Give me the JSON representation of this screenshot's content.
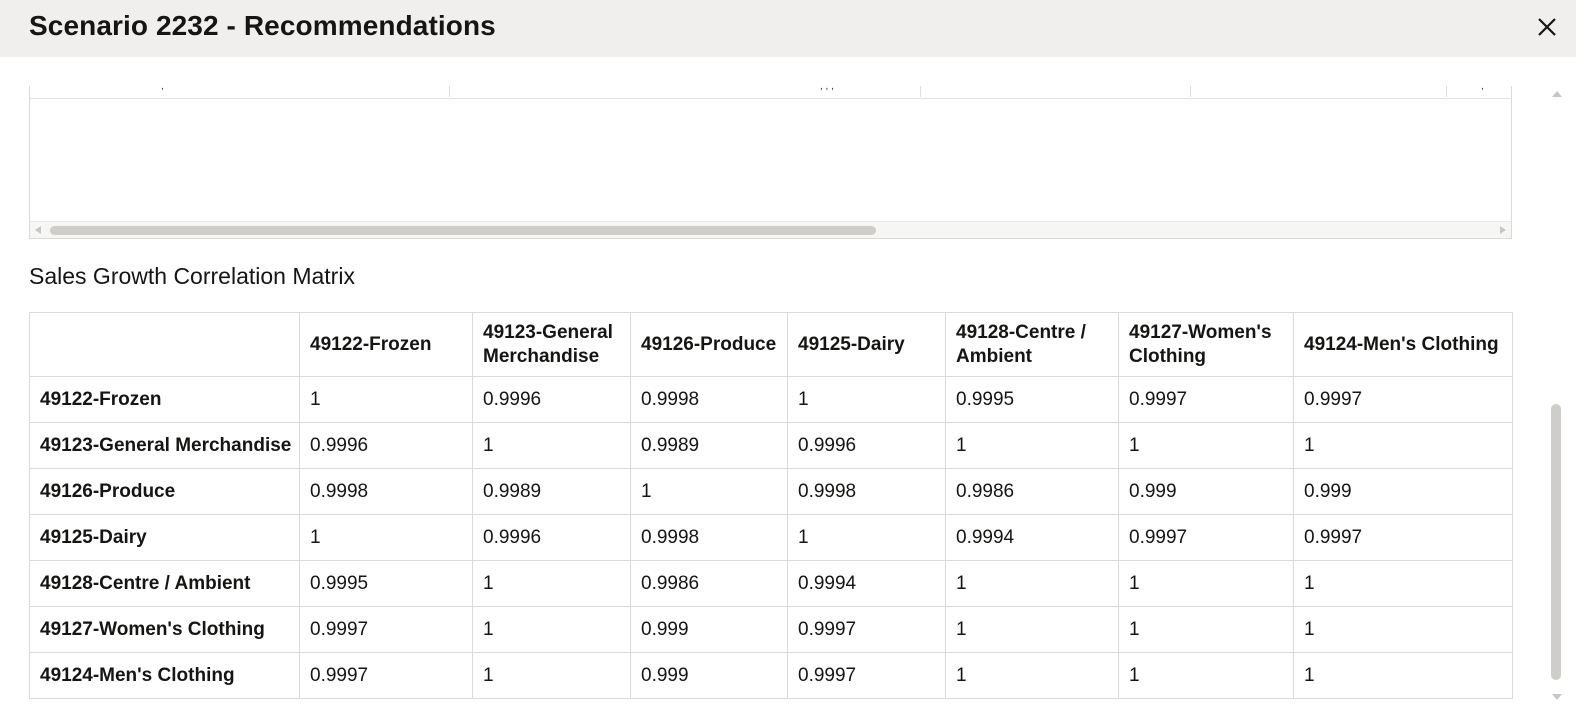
{
  "dialog": {
    "title": "Scenario 2232 - Recommendations",
    "close_icon": "close-icon"
  },
  "upper_grid": {
    "fragment_text": [
      ",",
      ", , ,",
      ","
    ]
  },
  "matrix": {
    "title": "Sales Growth Correlation Matrix",
    "columns": [
      "",
      "49122-Frozen",
      "49123-General Merchandise",
      "49126-Produce",
      "49125-Dairy",
      "49128-Centre / Ambient",
      "49127-Women's Clothing",
      "49124-Men's Clothing"
    ],
    "rows": [
      {
        "label": "49122-Frozen",
        "values": [
          "1",
          "0.9996",
          "0.9998",
          "1",
          "0.9995",
          "0.9997",
          "0.9997"
        ]
      },
      {
        "label": "49123-General Merchandise",
        "values": [
          "0.9996",
          "1",
          "0.9989",
          "0.9996",
          "1",
          "1",
          "1"
        ]
      },
      {
        "label": "49126-Produce",
        "values": [
          "0.9998",
          "0.9989",
          "1",
          "0.9998",
          "0.9986",
          "0.999",
          "0.999"
        ]
      },
      {
        "label": "49125-Dairy",
        "values": [
          "1",
          "0.9996",
          "0.9998",
          "1",
          "0.9994",
          "0.9997",
          "0.9997"
        ]
      },
      {
        "label": "49128-Centre / Ambient",
        "values": [
          "0.9995",
          "1",
          "0.9986",
          "0.9994",
          "1",
          "1",
          "1"
        ]
      },
      {
        "label": "49127-Women's Clothing",
        "values": [
          "0.9997",
          "1",
          "0.999",
          "0.9997",
          "1",
          "1",
          "1"
        ]
      },
      {
        "label": "49124-Men's Clothing",
        "values": [
          "0.9997",
          "1",
          "0.999",
          "0.9997",
          "1",
          "1",
          "1"
        ]
      }
    ]
  },
  "colors": {
    "header_bg": "#f1efed",
    "border": "#dcdad7",
    "text": "#161513",
    "scrollbar_thumb": "#cfcdca"
  }
}
